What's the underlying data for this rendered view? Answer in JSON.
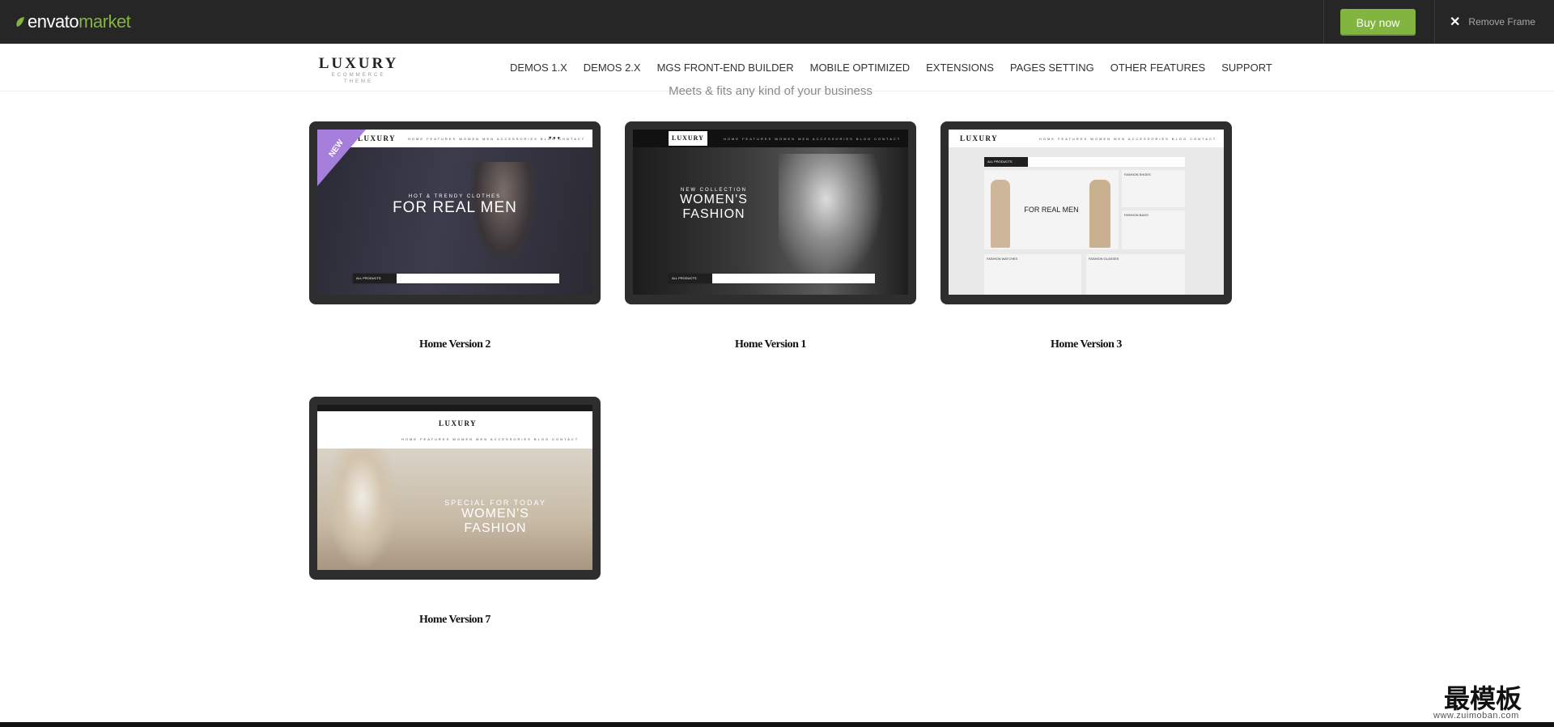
{
  "envato": {
    "logo_word1": "envato",
    "logo_word2": "market",
    "buy_label": "Buy now",
    "remove_frame_label": "Remove Frame",
    "accent_color": "#82b440"
  },
  "header": {
    "brand_name": "LUXURY",
    "brand_sub": "ECOMMERCE THEME",
    "nav": [
      "DEMOS 1.X",
      "DEMOS 2.X",
      "MGS FRONT-END BUILDER",
      "MOBILE OPTIMIZED",
      "EXTENSIONS",
      "PAGES SETTING",
      "OTHER FEATURES",
      "SUPPORT"
    ]
  },
  "tagline": "Meets & fits any kind of your business",
  "demos": [
    {
      "caption": "Home Version 2",
      "badge": "NEW",
      "hero_small": "HOT & TRENDY CLOTHES",
      "hero_big": "FOR REAL MEN",
      "search_cat": "ALL PRODUCTS"
    },
    {
      "caption": "Home Version 1",
      "hero_small": "NEW COLLECTION",
      "hero_big": "WOMEN'S FASHION",
      "search_cat": "ALL PRODUCTS"
    },
    {
      "caption": "Home Version 3",
      "hero_big": "FOR REAL MEN",
      "tiles": [
        "FASHION SHOES",
        "FASHION BAGS",
        "FASHION WATCHES",
        "FASHION GLASSES"
      ],
      "search_cat": "ALL PRODUCTS"
    },
    {
      "caption": "Home Version 7",
      "hero_small": "SPECIAL FOR TODAY",
      "hero_big": "WOMEN'S FASHION"
    }
  ],
  "watermark": {
    "text": "最模板",
    "url": "www.zuimoban.com"
  }
}
